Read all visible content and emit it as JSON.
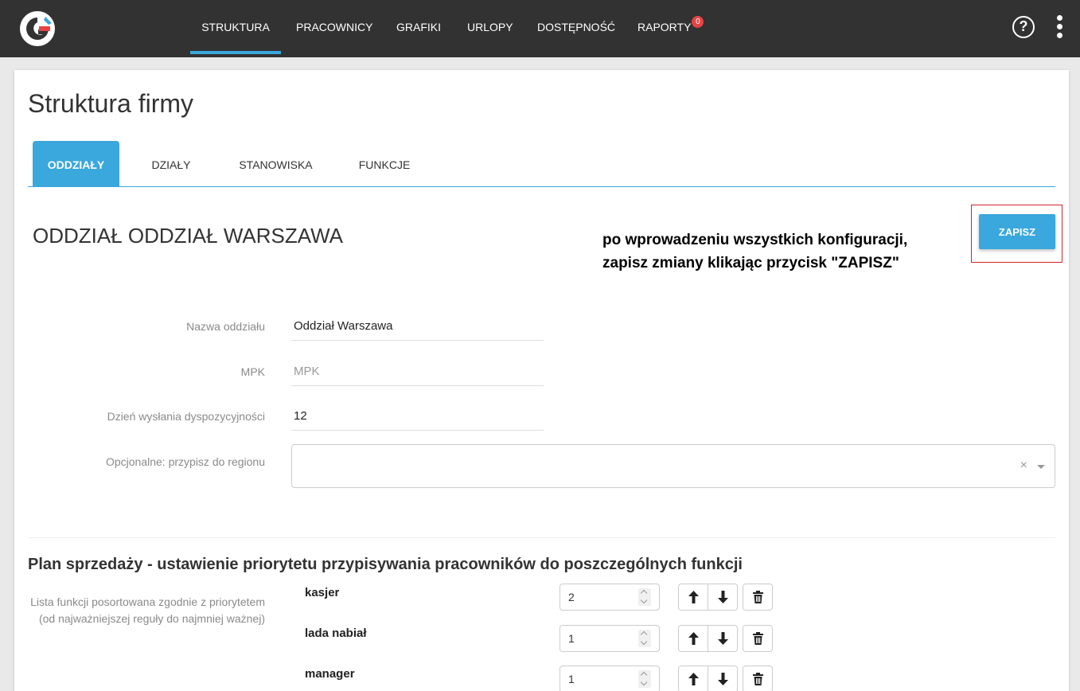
{
  "nav": {
    "items": [
      {
        "label": "STRUKTURA"
      },
      {
        "label": "PRACOWNICY"
      },
      {
        "label": "GRAFIKI"
      },
      {
        "label": "URLOPY"
      },
      {
        "label": "DOSTĘPNOŚĆ"
      },
      {
        "label": "RAPORTY",
        "badge": "0"
      }
    ],
    "help_symbol": "?"
  },
  "page": {
    "title": "Struktura firmy",
    "tabs": [
      "ODDZIAŁY",
      "DZIAŁY",
      "STANOWISKA",
      "FUNKCJE"
    ],
    "section_title": "ODDZIAŁ ODDZIAŁ WARSZAWA",
    "annotation": "po wprowadzeniu wszystkich konfiguracji, zapisz zmiany klikając przycisk \"ZAPISZ\"",
    "save_label": "ZAPISZ"
  },
  "form": {
    "name_label": "Nazwa oddziału",
    "name_value": "Oddział Warszawa",
    "mpk_label": "MPK",
    "mpk_placeholder": "MPK",
    "day_label": "Dzień wysłania dyspozycyjności",
    "day_value": "12",
    "region_label": "Opcjonalne: przypisz do regionu",
    "region_clear": "×"
  },
  "plan": {
    "title": "Plan sprzedaży - ustawienie priorytetu przypisywania pracowników do poszczególnych funkcji",
    "description": "Lista funkcji posortowana zgodnie z priorytetem (od najważniejszej reguły do najmniej ważnej)",
    "functions": [
      {
        "name": "kasjer",
        "value": "2"
      },
      {
        "name": "lada nabiał",
        "value": "1"
      },
      {
        "name": "manager",
        "value": "1"
      }
    ]
  },
  "colors": {
    "accent": "#3aa7dd",
    "topbar": "#323232",
    "badge": "#e84343",
    "highlight": "#d0242c"
  }
}
